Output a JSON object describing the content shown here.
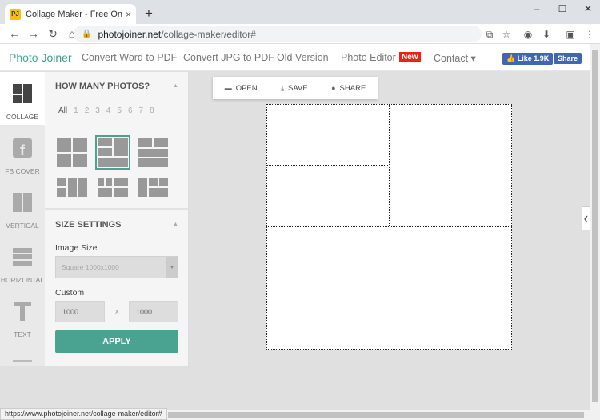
{
  "browser": {
    "tab_title": "Collage Maker - Free Online Ph",
    "tab_close": "×",
    "new_tab": "+",
    "window_controls": [
      "–",
      "☐",
      "✕"
    ],
    "url_host": "photojoiner.net",
    "url_path": "/collage-maker/editor#",
    "status_url": "https://www.photojoiner.net/collage-maker/editor#"
  },
  "site": {
    "logo_photo": "Photo",
    "logo_joiner": "Joiner",
    "nav": [
      "Convert Word to PDF",
      "Convert JPG to PDF",
      "Old Version",
      "Photo Editor",
      "Contact ▾"
    ],
    "new_badge": "New",
    "fb_like": "👍 Like 1.9K",
    "fb_share": "Share"
  },
  "rail": {
    "items": [
      "COLLAGE",
      "FB COVER",
      "VERTICAL",
      "HORIZONTAL",
      "TEXT"
    ]
  },
  "panel": {
    "how_many_title": "HOW MANY PHOTOS?",
    "counts": [
      "All",
      "1",
      "2",
      "3",
      "4",
      "5",
      "6",
      "7",
      "8"
    ],
    "size_title": "SIZE SETTINGS",
    "image_size_label": "Image Size",
    "image_size_value": "Square 1000x1000",
    "custom_label": "Custom",
    "width_value": "1000",
    "x_sep": "x",
    "height_value": "1000",
    "apply_label": "APPLY"
  },
  "toolbar": {
    "open": "OPEN",
    "save": "SAVE",
    "share": "SHARE"
  },
  "colors": {
    "accent": "#4aa391",
    "badge_red": "#ee2211",
    "fb_blue": "#4267b2"
  }
}
